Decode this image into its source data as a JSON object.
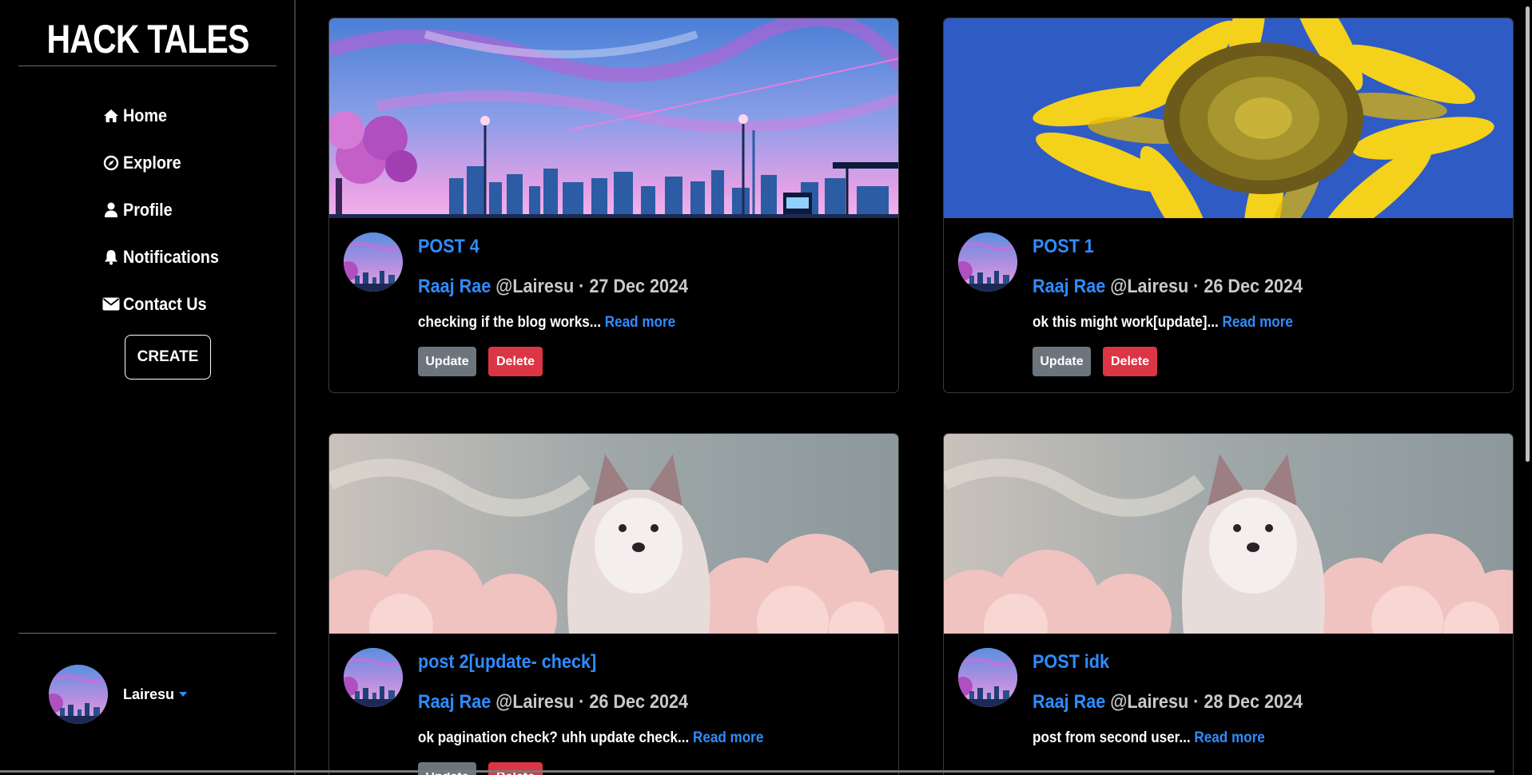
{
  "sidebar": {
    "brand": "HACK TALES",
    "nav": [
      {
        "label": "Home",
        "icon": "home-icon"
      },
      {
        "label": "Explore",
        "icon": "compass-icon"
      },
      {
        "label": "Profile",
        "icon": "user-icon"
      },
      {
        "label": "Notifications",
        "icon": "bell-icon"
      },
      {
        "label": "Contact Us",
        "icon": "envelope-icon"
      }
    ],
    "create_label": "CREATE",
    "username": "Lairesu"
  },
  "posts": [
    {
      "title": "POST 4",
      "author": "Raaj Rae",
      "handle": "@Lairesu",
      "date": "27 Dec 2024",
      "excerpt": "checking if the blog works...",
      "read_more": "Read more",
      "update_label": "Update",
      "delete_label": "Delete",
      "image": "city-skyline-sunset"
    },
    {
      "title": "POST 1",
      "author": "Raaj Rae",
      "handle": "@Lairesu",
      "date": "26 Dec 2024",
      "excerpt": "ok this might work[update]...",
      "read_more": "Read more",
      "update_label": "Update",
      "delete_label": "Delete",
      "image": "sunflower"
    },
    {
      "title": "post 2[update- check]",
      "author": "Raaj Rae",
      "handle": "@Lairesu",
      "date": "26 Dec 2024",
      "excerpt": "ok pagination check? uhh update check...",
      "read_more": "Read more",
      "update_label": "Update",
      "delete_label": "Delete",
      "image": "puppy-clouds"
    },
    {
      "title": "POST idk",
      "author": "Raaj Rae",
      "handle": "@Lairesu",
      "date": "28 Dec 2024",
      "excerpt": "post from second user...",
      "read_more": "Read more",
      "image": "puppy-clouds"
    }
  ],
  "meta_separator": "·",
  "colors": {
    "link": "#2f8cff",
    "update": "#6c757d",
    "delete": "#dc3545",
    "background": "#000000"
  }
}
